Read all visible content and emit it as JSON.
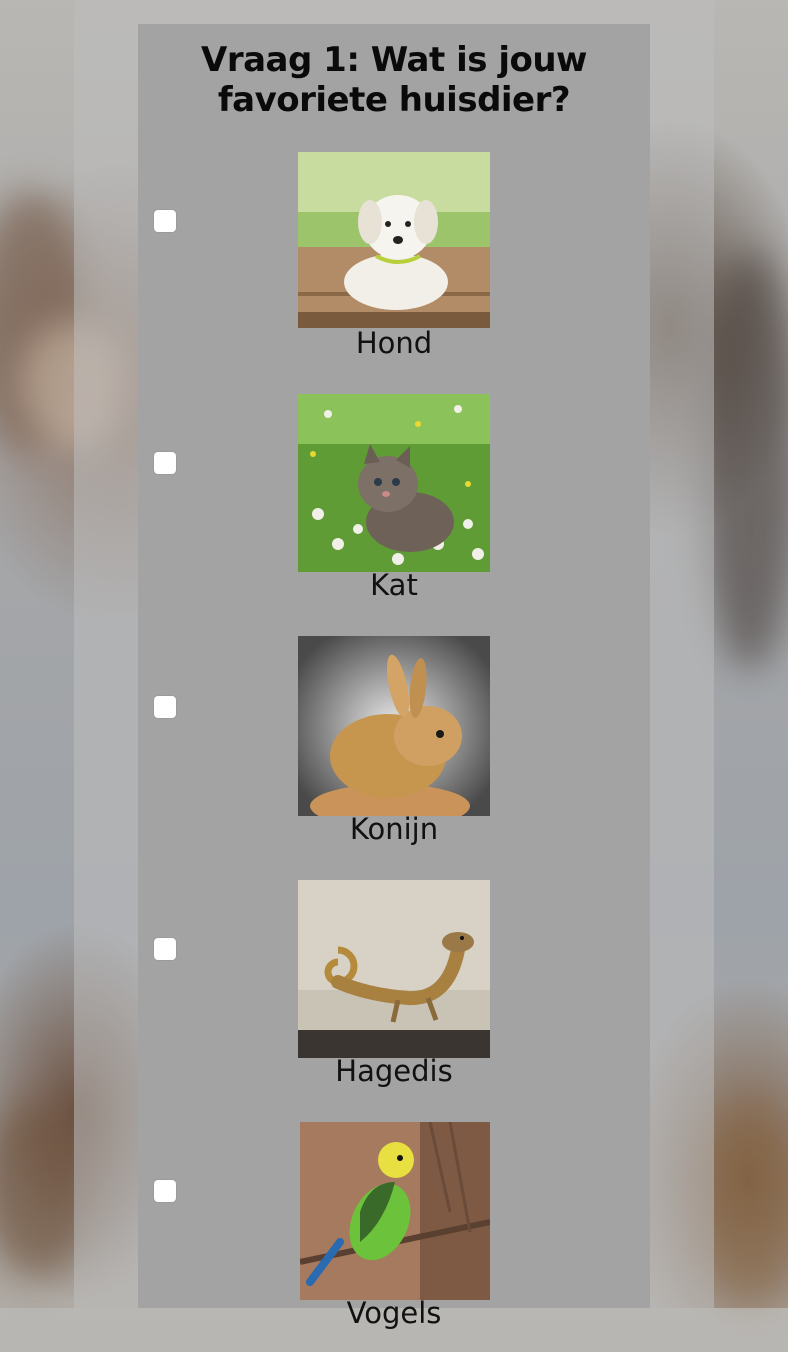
{
  "question": {
    "title": "Vraag 1: Wat is jouw favoriete huisdier?"
  },
  "options": [
    {
      "label": "Hond",
      "image": "puppy-photo"
    },
    {
      "label": "Kat",
      "image": "kitten-photo"
    },
    {
      "label": "Konijn",
      "image": "rabbit-photo"
    },
    {
      "label": "Hagedis",
      "image": "lizard-photo"
    },
    {
      "label": "Vogels",
      "image": "parakeet-photo"
    }
  ]
}
